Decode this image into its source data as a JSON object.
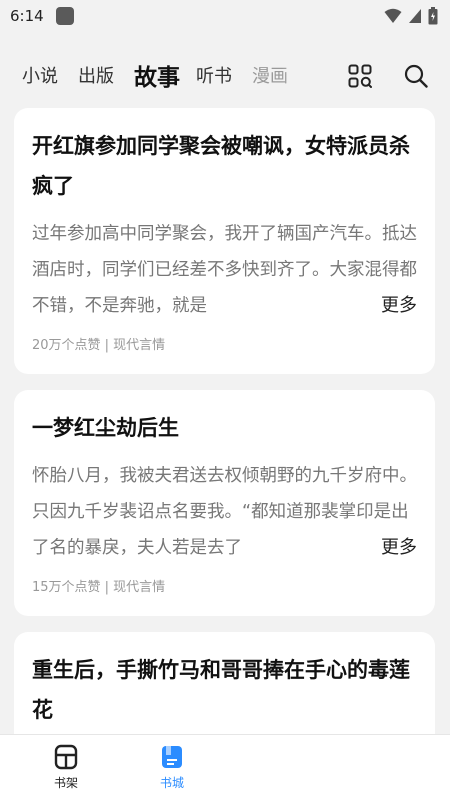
{
  "status_bar": {
    "time": "6:14",
    "icons": [
      "app-notification-icon",
      "wifi-icon",
      "signal-icon",
      "battery-icon"
    ]
  },
  "nav": {
    "tabs": [
      {
        "label": "小说",
        "active": false
      },
      {
        "label": "出版",
        "active": false
      },
      {
        "label": "故事",
        "active": true
      },
      {
        "label": "听书",
        "active": false
      },
      {
        "label": "漫画",
        "active": false
      }
    ],
    "icons": [
      "category-grid-icon",
      "search-icon"
    ]
  },
  "cards": [
    {
      "title": "开红旗参加同学聚会被嘲讽，女特派员杀疯了",
      "summary": "过年参加高中同学聚会，我开了辆国产汽车。抵达酒店时，同学们已经差不多快到齐了。大家混得都不错，不是奔驰，就是",
      "more": "更多",
      "meta": "20万个点赞 | 现代言情"
    },
    {
      "title": "一梦红尘劫后生",
      "summary": "怀胎八月，我被夫君送去权倾朝野的九千岁府中。只因九千岁裴诏点名要我。“都知道那裴掌印是出了名的暴戾，夫人若是去了",
      "more": "更多",
      "meta": "15万个点赞 | 现代言情"
    },
    {
      "title": "重生后，手撕竹马和哥哥捧在手心的毒莲花",
      "summary": "",
      "more": "",
      "meta": ""
    }
  ],
  "bottom_nav": {
    "bookshelf_label": "书架",
    "store_label": "书城",
    "active": "书城",
    "accent_color": "#2b8cff"
  }
}
